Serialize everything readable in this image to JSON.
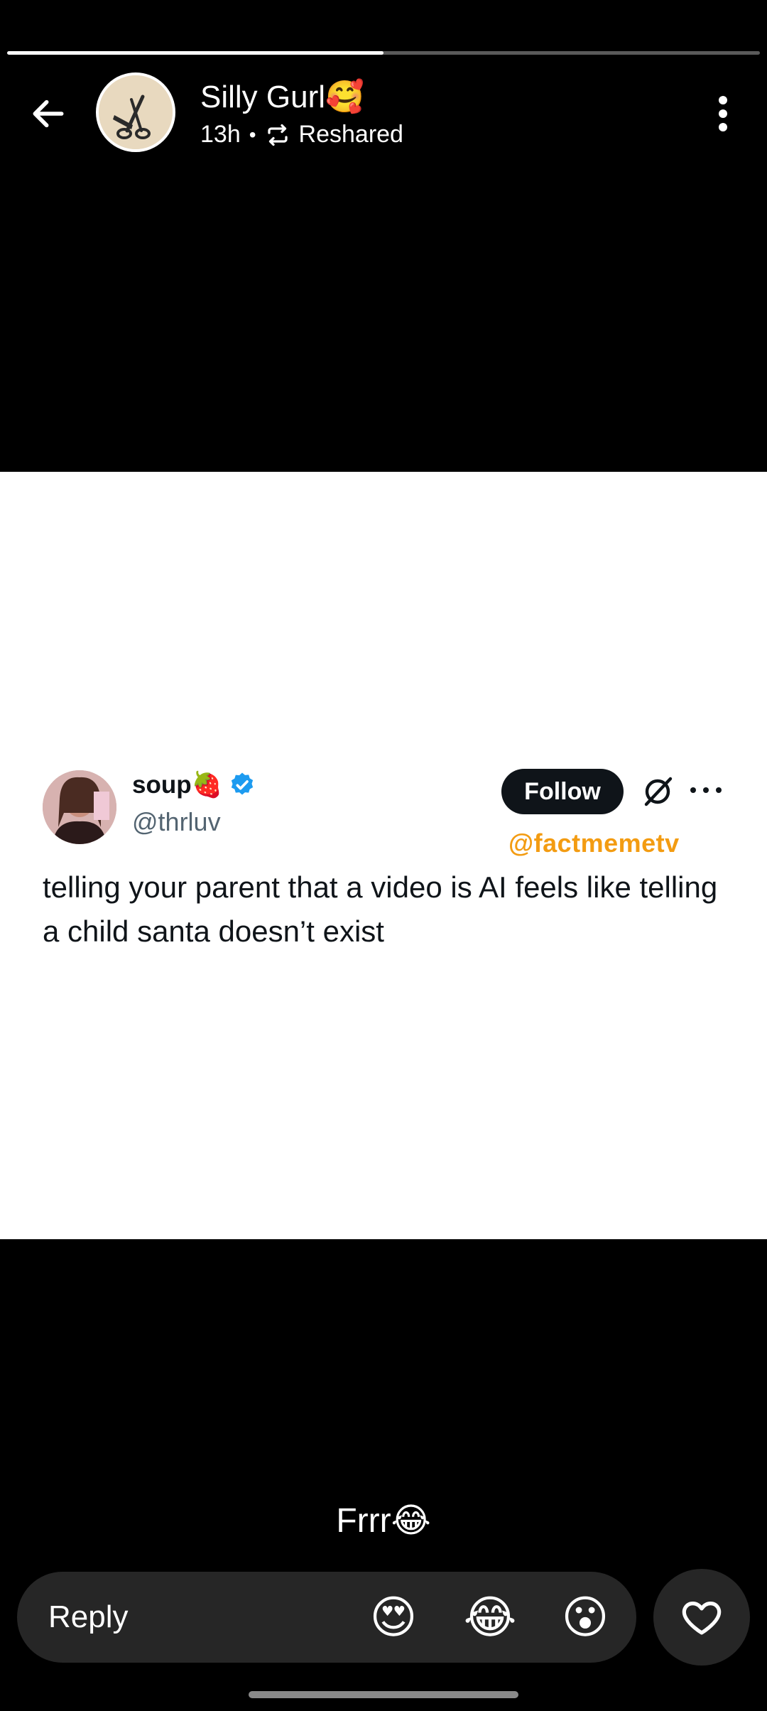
{
  "story": {
    "progress_fraction": 0.5
  },
  "header": {
    "username": "Silly Gurl🥰",
    "time": "13h",
    "dot": "•",
    "reshared_label": "Reshared"
  },
  "post": {
    "author_name": "soup🍓",
    "author_handle": "@thrluv",
    "follow_label": "Follow",
    "watermark": "@factmemetv",
    "text": "telling your parent that a video is AI feels like telling a child santa doesn’t exist"
  },
  "caption": "Frrr😂",
  "reply": {
    "placeholder": "Reply",
    "emoji_1": "😍",
    "emoji_2": "😂",
    "emoji_3": "😮"
  }
}
